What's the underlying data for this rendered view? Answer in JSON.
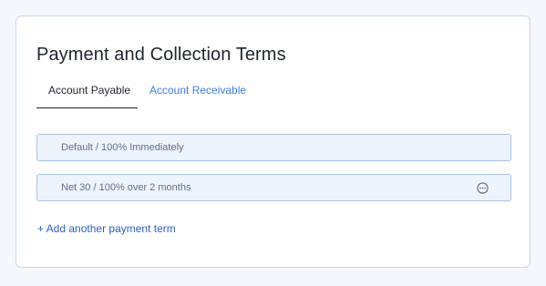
{
  "section": {
    "title": "Payment and Collection Terms"
  },
  "tabs": [
    {
      "label": "Account Payable",
      "active": true
    },
    {
      "label": "Account Receivable",
      "active": false
    }
  ],
  "terms": [
    {
      "label": "Default / 100% Immediately",
      "has_menu": false
    },
    {
      "label": "Net 30 / 100% over 2 months",
      "has_menu": true,
      "menu_icon": "more-horizontal-circle-icon"
    }
  ],
  "actions": {
    "add_term_label": "+ Add another payment term"
  },
  "colors": {
    "accent": "#3f7be8",
    "link": "#2f5fc4",
    "row_background": "#eef4fd",
    "row_border": "#a9c2e6",
    "card_border": "#c9d6ea"
  }
}
